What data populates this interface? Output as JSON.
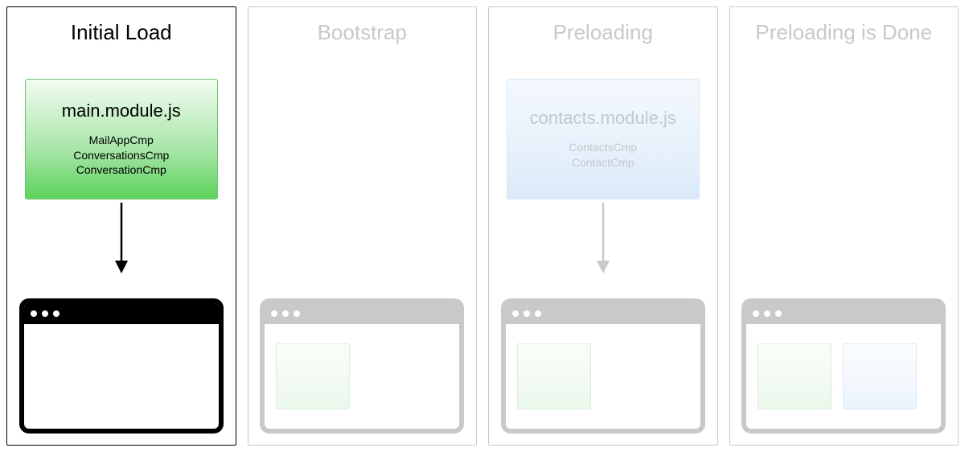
{
  "panels": [
    {
      "title": "Initial Load",
      "active": true,
      "module": {
        "color": "green",
        "title": "main.module.js",
        "items": [
          "MailAppCmp",
          "ConversationsCmp",
          "ConversationCmp"
        ]
      },
      "arrow": true,
      "browser": {
        "faded": false,
        "miniGreen": false,
        "miniBlue": false
      }
    },
    {
      "title": "Bootstrap",
      "active": false,
      "module": null,
      "arrow": false,
      "browser": {
        "faded": true,
        "miniGreen": true,
        "miniBlue": false
      }
    },
    {
      "title": "Preloading",
      "active": false,
      "module": {
        "color": "blue",
        "title": "contacts.module.js",
        "items": [
          "ContactsCmp",
          "ContactCmp"
        ]
      },
      "arrow": true,
      "browser": {
        "faded": true,
        "miniGreen": true,
        "miniBlue": false
      }
    },
    {
      "title": "Preloading is Done",
      "active": false,
      "module": null,
      "arrow": false,
      "browser": {
        "faded": true,
        "miniGreen": true,
        "miniBlue": true
      }
    }
  ],
  "colors": {
    "active_border": "#000000",
    "faded": "#c9c9c9",
    "green_accent": "#5dd25d",
    "blue_accent": "#daeafa"
  }
}
